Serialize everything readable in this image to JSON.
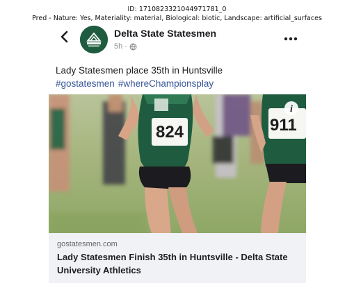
{
  "caption": {
    "id_line": "ID: 1710823321044971781_0",
    "pred_line": "Pred - Nature: Yes, Materiality: material, Biological: biotic, Landscape: artificial_surfaces"
  },
  "post": {
    "page_name": "Delta State Statesmen",
    "time": "5h",
    "separator": "·",
    "text": "Lady Statesmen place 35th in Huntsville",
    "hashtags": [
      "#gostatesmen",
      "#whereChampionsplay"
    ],
    "photo": {
      "bibs": [
        "824",
        "911"
      ]
    },
    "link": {
      "domain": "gostatesmen.com",
      "title": "Lady Statesmen Finish 35th in Huntsville - Delta State University Athletics"
    }
  },
  "colors": {
    "brand_green": "#1f5c3f",
    "hashtag_blue": "#385898",
    "link_bg": "#f0f2f5"
  },
  "icons": [
    "back-arrow-icon",
    "globe-icon",
    "more-options-icon",
    "info-icon"
  ]
}
